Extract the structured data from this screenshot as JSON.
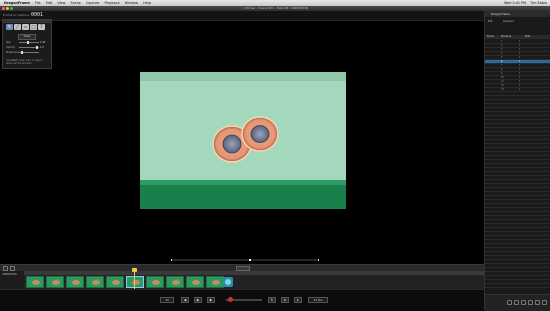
{
  "menubar": {
    "app_name": "DragonFrame",
    "items": [
      "File",
      "Edit",
      "View",
      "Scene",
      "Capture",
      "Playback",
      "Window",
      "Help"
    ],
    "right_items": [
      "Wed 3:41 PM",
      "Tim Ebbin"
    ]
  },
  "window": {
    "title": "c_08.hse - Scene 001 · Take 08 · ANIMATION"
  },
  "toolbar": {
    "frame_label": "Frame to Capture",
    "frame_counter": "0001"
  },
  "toolpanel": {
    "tools": [
      "pen",
      "line",
      "rect",
      "ellipse",
      "text",
      "eraser"
    ],
    "clear_label": "Clear",
    "sliders": [
      {
        "label": "Size",
        "value": "1.50"
      },
      {
        "label": "Opacity",
        "value": "1.0"
      },
      {
        "label": "Brightness",
        "value": ""
      }
    ],
    "note": "Use DRAW mode, hold, or drag to draw over the live feed"
  },
  "timeline": {
    "header_label": "",
    "track_labels": [
      "ANIMATION",
      "Camera"
    ],
    "playhead_frame": 13
  },
  "transport": {
    "fps_value": "15",
    "speed_value": "24 fps",
    "buttons": [
      "step-back",
      "play",
      "step-forward"
    ],
    "loop_buttons": [
      "loop",
      "bounce",
      "short-play"
    ]
  },
  "rpanel": {
    "title": "DragonFrame",
    "tabs": [
      "Edit",
      "Exposure"
    ],
    "columns": [
      "Frame",
      "Exposure",
      "Note"
    ],
    "rows": [
      {
        "frame": "1",
        "exposure": "1"
      },
      {
        "frame": "2",
        "exposure": "1"
      },
      {
        "frame": "3",
        "exposure": "1"
      },
      {
        "frame": "4",
        "exposure": "1"
      },
      {
        "frame": "5",
        "exposure": "1"
      },
      {
        "frame": "6",
        "exposure": "1"
      },
      {
        "frame": "7",
        "exposure": "1"
      },
      {
        "frame": "8",
        "exposure": "1"
      },
      {
        "frame": "9",
        "exposure": "1"
      },
      {
        "frame": "10",
        "exposure": "1"
      },
      {
        "frame": "11",
        "exposure": "1"
      },
      {
        "frame": "12",
        "exposure": "1"
      },
      {
        "frame": "13",
        "exposure": "1"
      }
    ]
  },
  "colors": {
    "stage_bg": "#a4d8bc",
    "floor": "#1a7f4b",
    "playhead": "#f2c94c",
    "highlight": "#2b6a9f"
  }
}
